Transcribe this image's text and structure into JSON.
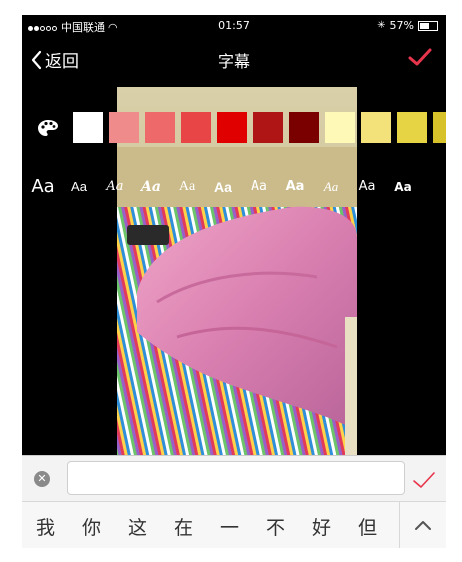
{
  "status_bar": {
    "carrier": "中国联通",
    "time": "01:57",
    "battery": "57%",
    "battery_fraction": 0.57
  },
  "nav": {
    "back_label": "返回",
    "title": "字幕"
  },
  "colors": {
    "accent": "#e8354b",
    "swatches": [
      "#ffffff",
      "#f08b8b",
      "#ee6a6a",
      "#e84646",
      "#e00000",
      "#b01515",
      "#7a0000",
      "#fff9b8",
      "#f3e27a",
      "#e7d444",
      "#d8c22a"
    ]
  },
  "font_styles": [
    "Aa",
    "Aa",
    "Aa",
    "Aa",
    "Aa",
    "Aa",
    "Aa",
    "Aa",
    "Aa",
    "Aa",
    "Aa"
  ],
  "text_input": {
    "value": "",
    "placeholder": ""
  },
  "candidates": [
    "我",
    "你",
    "这",
    "在",
    "一",
    "不",
    "好",
    "但"
  ],
  "icons": {
    "palette": "palette-icon",
    "back": "chevron-left-icon",
    "confirm": "checkmark-icon",
    "clear": "clear-icon",
    "expand": "chevron-up-icon"
  }
}
